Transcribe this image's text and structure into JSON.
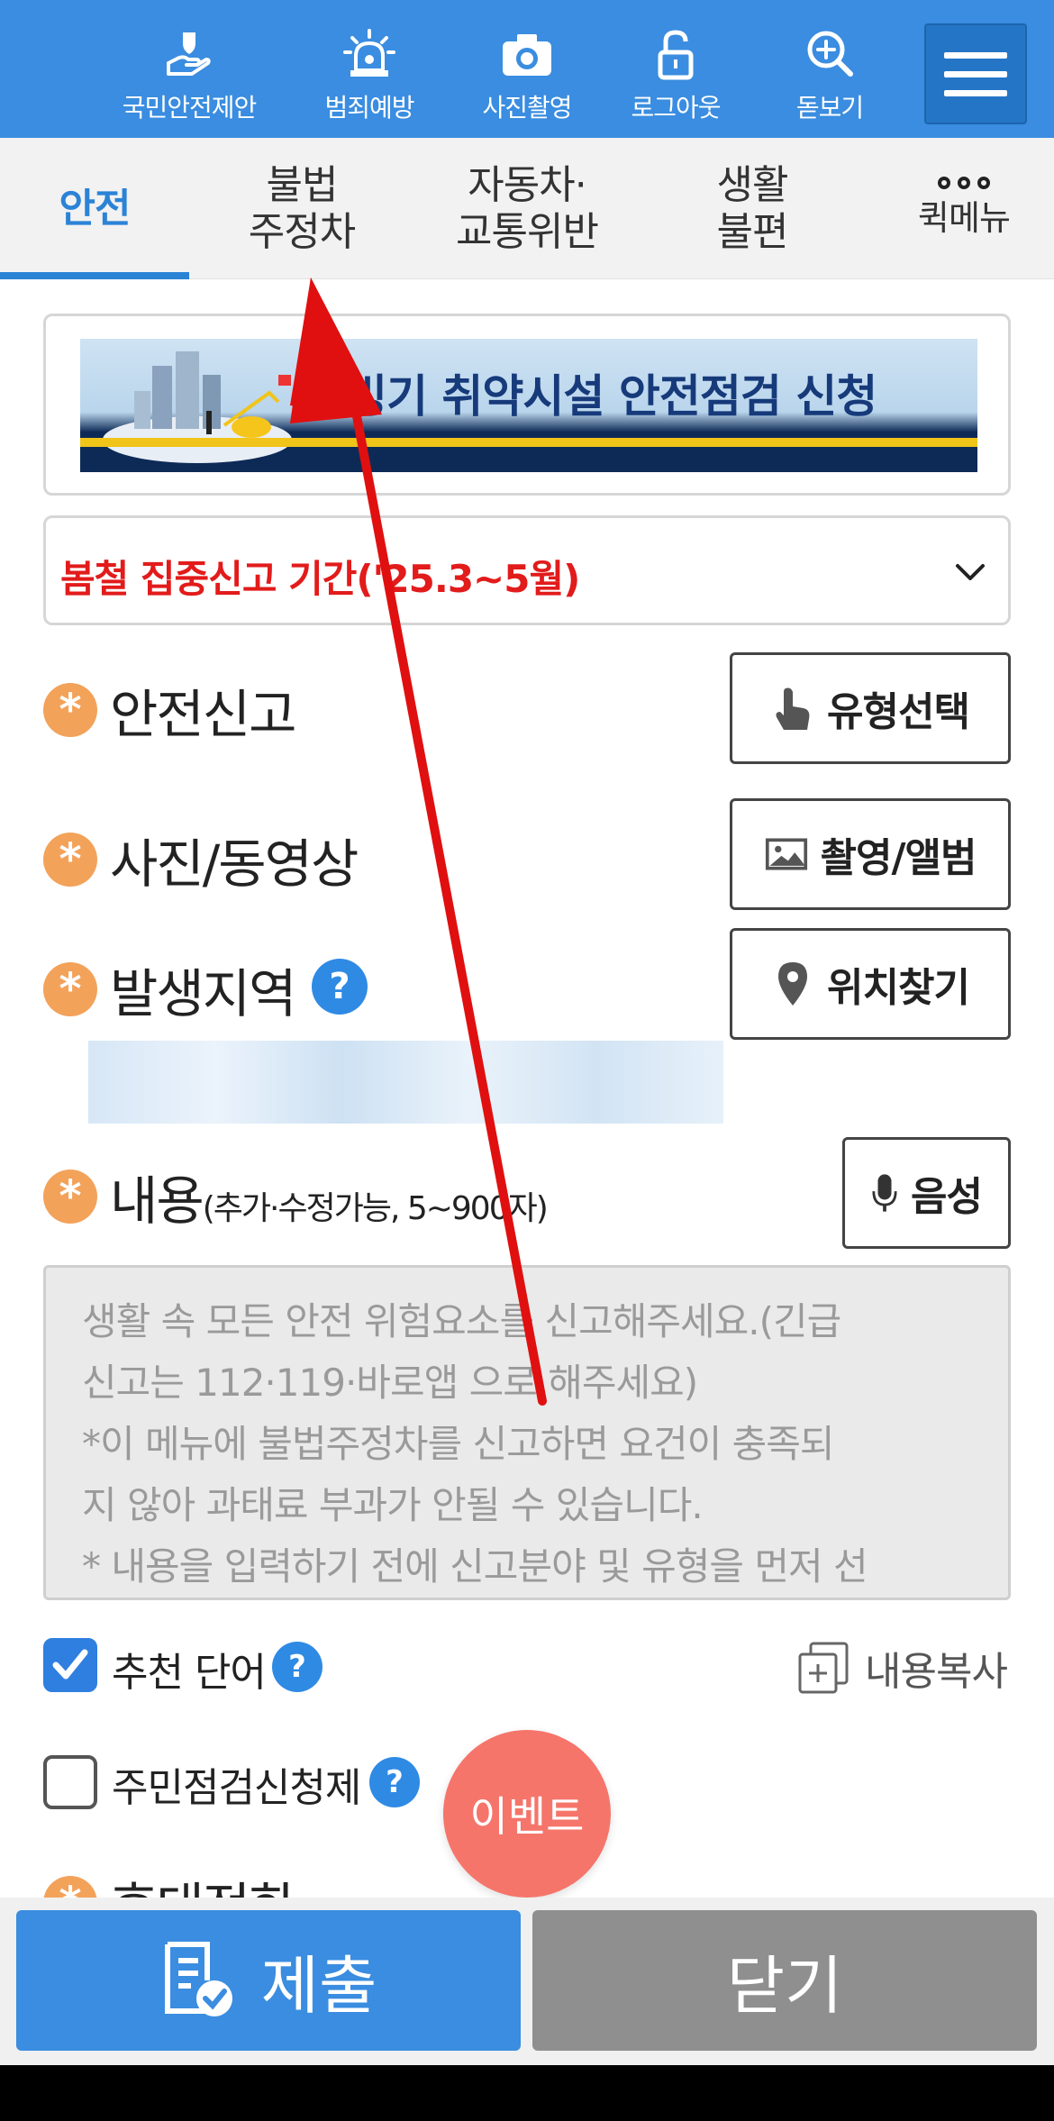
{
  "toolbar": {
    "items": [
      {
        "label": "국민안전제안",
        "icon": "hand-shield-icon"
      },
      {
        "label": "범죄예방",
        "icon": "siren-icon"
      },
      {
        "label": "사진촬영",
        "icon": "camera-icon"
      },
      {
        "label": "로그아웃",
        "icon": "unlock-icon"
      },
      {
        "label": "돋보기",
        "icon": "magnifier-plus-icon"
      }
    ],
    "menu_icon": "hamburger-menu-icon"
  },
  "tabs": [
    {
      "label": "안전",
      "active": true
    },
    {
      "label": "불법\n주정차",
      "active": false
    },
    {
      "label": "자동차·\n교통위반",
      "active": false
    },
    {
      "label": "생활\n불편",
      "active": false
    },
    {
      "label": "퀵메뉴",
      "active": false
    }
  ],
  "banner": {
    "text": "미빙기 취약시설 안전점검 신청"
  },
  "notice_select": {
    "value": "봄철 집중신고 기간('25.3~5월)"
  },
  "colors": {
    "primary": "#3a8de0",
    "alert_red": "#e21b1b",
    "required_orange": "#f3a25a",
    "event_pink": "#f5756b"
  },
  "form": {
    "report_type": {
      "label": "안전신고",
      "button": "유형선택"
    },
    "media": {
      "label": "사진/동영상",
      "button": "촬영/앨범"
    },
    "location": {
      "label": "발생지역",
      "help": "?",
      "button": "위치찾기"
    },
    "content": {
      "label": "내용",
      "hint": "(추가·수정가능, 5~900자)",
      "voice_button": "음성",
      "placeholder_lines": [
        "생활 속 모든 안전 위험요소를 신고해주세요.(긴급",
        "신고는 112·119·바로앱 으로 해주세요)",
        "*이 메뉴에 불법주정차를 신고하면 요건이 충족되",
        "지 않아 과태료 부과가 안될 수 있습니다.",
        "* 내용을 입력하기 전에 신고분야 및 유형을 먼저 선"
      ]
    },
    "recommend": {
      "label": "추천 단어",
      "checked": true,
      "help": "?"
    },
    "copy": {
      "label": "내용복사"
    },
    "resident_check": {
      "label": "주민점검신청제",
      "checked": false,
      "help": "?"
    },
    "phone": {
      "label": "휴대전화"
    }
  },
  "event_button": {
    "label": "이벤트"
  },
  "bottom": {
    "submit": "제출",
    "close": "닫기"
  }
}
